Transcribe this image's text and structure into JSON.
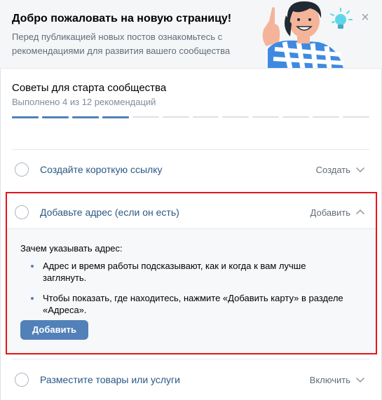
{
  "banner": {
    "title": "Добро пожаловать на новую страницу!",
    "subtitle": "Перед публикацией новых постов ознакомьтесь с рекомендациями для развития вашего сообщества",
    "close_icon": "×"
  },
  "progress": {
    "title": "Советы для старта сообщества",
    "status": "Выполнено 4 из 12 рекомендаций",
    "completed": 4,
    "total": 12
  },
  "tasks": [
    {
      "label": "Создайте короткую ссылку",
      "action": "Создать",
      "expanded": false
    },
    {
      "label": "Добавьте адрес (если он есть)",
      "action": "Добавить",
      "expanded": true
    },
    {
      "label": "Разместите товары или услуги",
      "action": "Включить",
      "expanded": false
    }
  ],
  "expanded": {
    "question": "Зачем указывать адрес:",
    "bullets": [
      "Адрес и время работы подсказывают, как и когда к вам лучше заглянуть.",
      "Чтобы показать, где находитесь, нажмите «Добавить карту» в разделе «Адреса»."
    ],
    "button_label": "Добавить"
  },
  "colors": {
    "accent": "#5181b8",
    "link": "#2a5885",
    "highlight": "#e3151a"
  }
}
